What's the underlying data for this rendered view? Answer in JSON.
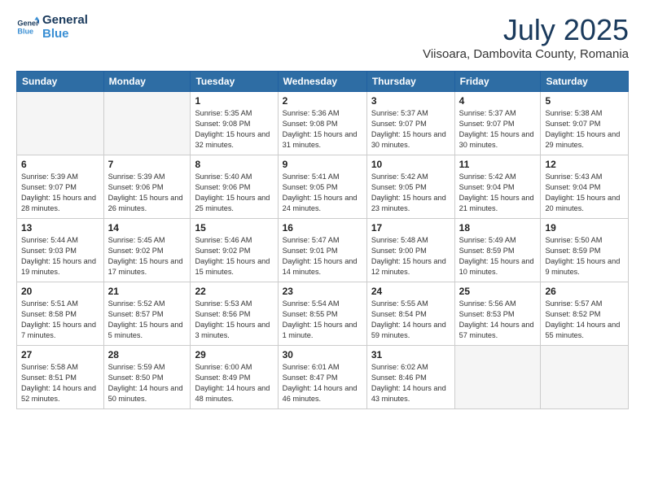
{
  "logo": {
    "line1": "General",
    "line2": "Blue"
  },
  "title": "July 2025",
  "location": "Viisoara, Dambovita County, Romania",
  "weekdays": [
    "Sunday",
    "Monday",
    "Tuesday",
    "Wednesday",
    "Thursday",
    "Friday",
    "Saturday"
  ],
  "weeks": [
    [
      {
        "day": "",
        "info": ""
      },
      {
        "day": "",
        "info": ""
      },
      {
        "day": "1",
        "info": "Sunrise: 5:35 AM\nSunset: 9:08 PM\nDaylight: 15 hours and 32 minutes."
      },
      {
        "day": "2",
        "info": "Sunrise: 5:36 AM\nSunset: 9:08 PM\nDaylight: 15 hours and 31 minutes."
      },
      {
        "day": "3",
        "info": "Sunrise: 5:37 AM\nSunset: 9:07 PM\nDaylight: 15 hours and 30 minutes."
      },
      {
        "day": "4",
        "info": "Sunrise: 5:37 AM\nSunset: 9:07 PM\nDaylight: 15 hours and 30 minutes."
      },
      {
        "day": "5",
        "info": "Sunrise: 5:38 AM\nSunset: 9:07 PM\nDaylight: 15 hours and 29 minutes."
      }
    ],
    [
      {
        "day": "6",
        "info": "Sunrise: 5:39 AM\nSunset: 9:07 PM\nDaylight: 15 hours and 28 minutes."
      },
      {
        "day": "7",
        "info": "Sunrise: 5:39 AM\nSunset: 9:06 PM\nDaylight: 15 hours and 26 minutes."
      },
      {
        "day": "8",
        "info": "Sunrise: 5:40 AM\nSunset: 9:06 PM\nDaylight: 15 hours and 25 minutes."
      },
      {
        "day": "9",
        "info": "Sunrise: 5:41 AM\nSunset: 9:05 PM\nDaylight: 15 hours and 24 minutes."
      },
      {
        "day": "10",
        "info": "Sunrise: 5:42 AM\nSunset: 9:05 PM\nDaylight: 15 hours and 23 minutes."
      },
      {
        "day": "11",
        "info": "Sunrise: 5:42 AM\nSunset: 9:04 PM\nDaylight: 15 hours and 21 minutes."
      },
      {
        "day": "12",
        "info": "Sunrise: 5:43 AM\nSunset: 9:04 PM\nDaylight: 15 hours and 20 minutes."
      }
    ],
    [
      {
        "day": "13",
        "info": "Sunrise: 5:44 AM\nSunset: 9:03 PM\nDaylight: 15 hours and 19 minutes."
      },
      {
        "day": "14",
        "info": "Sunrise: 5:45 AM\nSunset: 9:02 PM\nDaylight: 15 hours and 17 minutes."
      },
      {
        "day": "15",
        "info": "Sunrise: 5:46 AM\nSunset: 9:02 PM\nDaylight: 15 hours and 15 minutes."
      },
      {
        "day": "16",
        "info": "Sunrise: 5:47 AM\nSunset: 9:01 PM\nDaylight: 15 hours and 14 minutes."
      },
      {
        "day": "17",
        "info": "Sunrise: 5:48 AM\nSunset: 9:00 PM\nDaylight: 15 hours and 12 minutes."
      },
      {
        "day": "18",
        "info": "Sunrise: 5:49 AM\nSunset: 8:59 PM\nDaylight: 15 hours and 10 minutes."
      },
      {
        "day": "19",
        "info": "Sunrise: 5:50 AM\nSunset: 8:59 PM\nDaylight: 15 hours and 9 minutes."
      }
    ],
    [
      {
        "day": "20",
        "info": "Sunrise: 5:51 AM\nSunset: 8:58 PM\nDaylight: 15 hours and 7 minutes."
      },
      {
        "day": "21",
        "info": "Sunrise: 5:52 AM\nSunset: 8:57 PM\nDaylight: 15 hours and 5 minutes."
      },
      {
        "day": "22",
        "info": "Sunrise: 5:53 AM\nSunset: 8:56 PM\nDaylight: 15 hours and 3 minutes."
      },
      {
        "day": "23",
        "info": "Sunrise: 5:54 AM\nSunset: 8:55 PM\nDaylight: 15 hours and 1 minute."
      },
      {
        "day": "24",
        "info": "Sunrise: 5:55 AM\nSunset: 8:54 PM\nDaylight: 14 hours and 59 minutes."
      },
      {
        "day": "25",
        "info": "Sunrise: 5:56 AM\nSunset: 8:53 PM\nDaylight: 14 hours and 57 minutes."
      },
      {
        "day": "26",
        "info": "Sunrise: 5:57 AM\nSunset: 8:52 PM\nDaylight: 14 hours and 55 minutes."
      }
    ],
    [
      {
        "day": "27",
        "info": "Sunrise: 5:58 AM\nSunset: 8:51 PM\nDaylight: 14 hours and 52 minutes."
      },
      {
        "day": "28",
        "info": "Sunrise: 5:59 AM\nSunset: 8:50 PM\nDaylight: 14 hours and 50 minutes."
      },
      {
        "day": "29",
        "info": "Sunrise: 6:00 AM\nSunset: 8:49 PM\nDaylight: 14 hours and 48 minutes."
      },
      {
        "day": "30",
        "info": "Sunrise: 6:01 AM\nSunset: 8:47 PM\nDaylight: 14 hours and 46 minutes."
      },
      {
        "day": "31",
        "info": "Sunrise: 6:02 AM\nSunset: 8:46 PM\nDaylight: 14 hours and 43 minutes."
      },
      {
        "day": "",
        "info": ""
      },
      {
        "day": "",
        "info": ""
      }
    ]
  ]
}
